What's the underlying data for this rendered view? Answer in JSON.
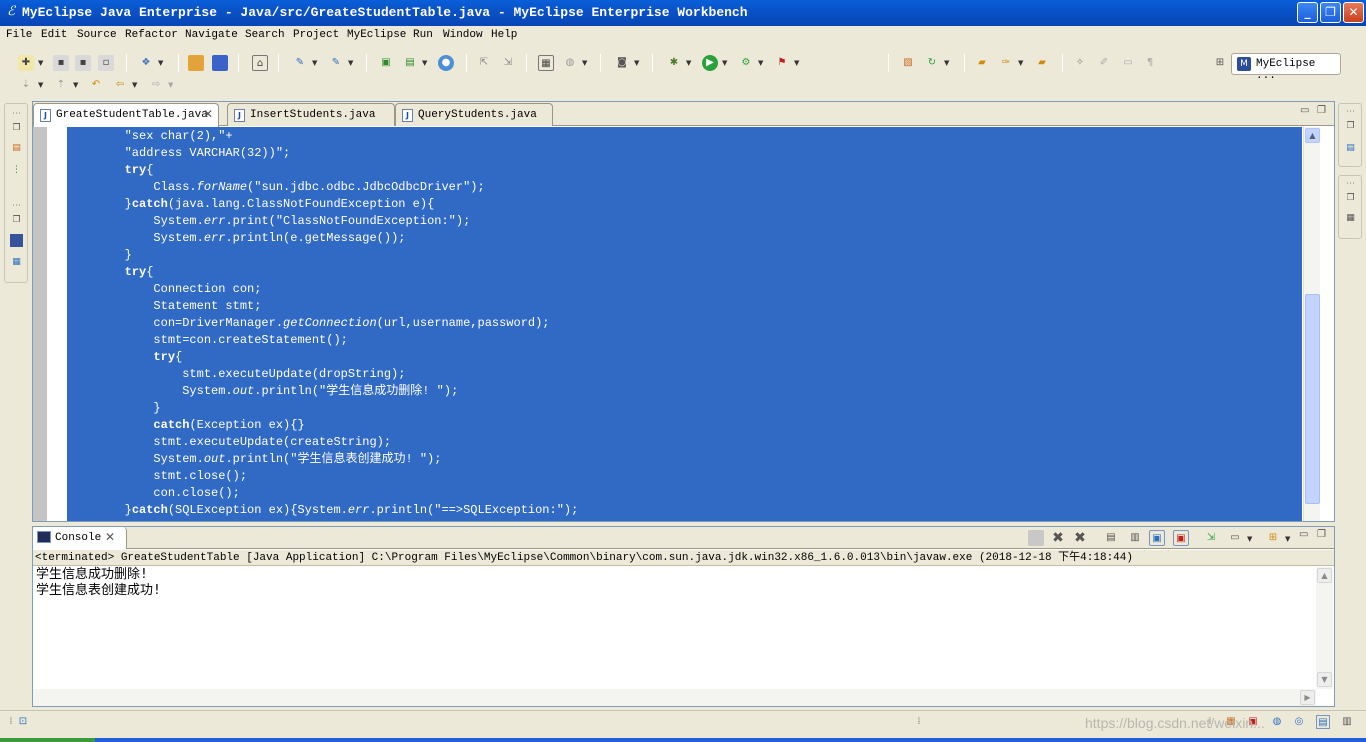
{
  "window": {
    "title": "MyEclipse Java Enterprise - Java/src/GreateStudentTable.java - MyEclipse Enterprise Workbench",
    "minimize": "_",
    "maximize": "❐",
    "close": "✕",
    "app_icon": "myeclipse-logo-icon"
  },
  "menu": [
    "File",
    "Edit",
    "Source",
    "Refactor",
    "Navigate",
    "Search",
    "Project",
    "MyEclipse",
    "Run",
    "Window",
    "Help"
  ],
  "perspective": {
    "label": "MyEclipse ...",
    "icon": "myeclipse-perspective-icon"
  },
  "editor": {
    "tabs": [
      {
        "label": "GreateStudentTable.java",
        "active": true,
        "closable": true
      },
      {
        "label": "InsertStudents.java",
        "active": false
      },
      {
        "label": "QueryStudents.java",
        "active": false
      }
    ],
    "code_lines": [
      "        \"sex char(2),\"+",
      "        \"address VARCHAR(32))\";",
      "        try{",
      "            Class.forName(\"sun.jdbc.odbc.JdbcOdbcDriver\");",
      "        }catch(java.lang.ClassNotFoundException e){",
      "            System.err.print(\"ClassNotFoundException:\");",
      "            System.err.println(e.getMessage());",
      "        }",
      "        try{",
      "            Connection con;",
      "            Statement stmt;",
      "            con=DriverManager.getConnection(url,username,password);",
      "            stmt=con.createStatement();",
      "            try{",
      "                stmt.executeUpdate(dropString);",
      "                System.out.println(\"学生信息成功删除! \");",
      "            }",
      "            catch(Exception ex){}",
      "            stmt.executeUpdate(createString);",
      "            System.out.println(\"学生信息表创建成功! \");",
      "            stmt.close();",
      "            con.close();",
      "        }catch(SQLException ex){System.err.println(\"==>SQLException:\");"
    ],
    "selection_color": "#316ac5"
  },
  "console": {
    "tab_label": "Console",
    "status": "<terminated> GreateStudentTable [Java Application] C:\\Program Files\\MyEclipse\\Common\\binary\\com.sun.java.jdk.win32.x86_1.6.0.013\\bin\\javaw.exe (2018-12-18 下午4:18:44)",
    "output": [
      "学生信息成功删除!",
      "学生信息表创建成功!"
    ]
  },
  "watermark": "https://blog.csdn.net/weixin..."
}
